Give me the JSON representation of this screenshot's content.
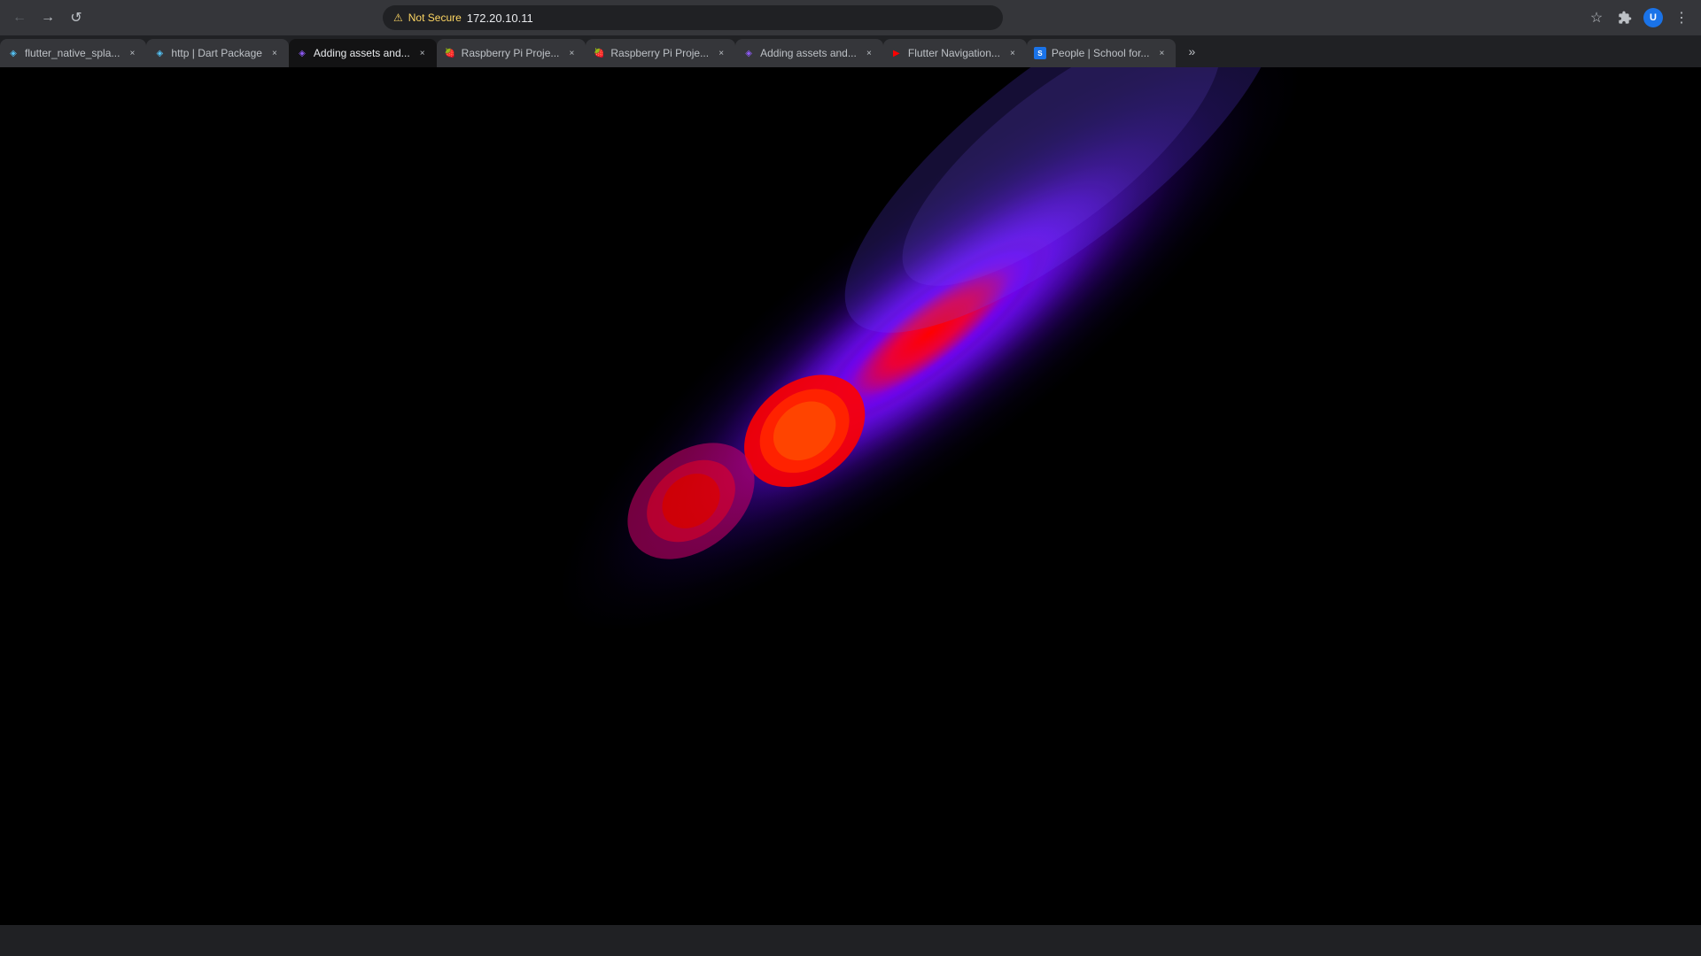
{
  "browser": {
    "url": "172.20.10.11",
    "security_label": "Not Secure",
    "nav": {
      "back_label": "←",
      "forward_label": "→",
      "reload_label": "↺"
    },
    "toolbar": {
      "bookmark_label": "☆",
      "extensions_label": "🧩",
      "menu_label": "⋮"
    }
  },
  "tabs": [
    {
      "id": "tab1",
      "title": "flutter_native_spla...",
      "favicon_type": "flutter",
      "active": false
    },
    {
      "id": "tab2",
      "title": "http | Dart Package",
      "favicon_type": "dart",
      "active": false
    },
    {
      "id": "tab3",
      "title": "Adding assets and...",
      "favicon_type": "flutter2",
      "active": true
    },
    {
      "id": "tab4",
      "title": "Raspberry Pi Proje...",
      "favicon_type": "raspi",
      "active": false
    },
    {
      "id": "tab5",
      "title": "Raspberry Pi Proje...",
      "favicon_type": "raspi",
      "active": false
    },
    {
      "id": "tab6",
      "title": "Adding assets and...",
      "favicon_type": "flutter2",
      "active": false
    },
    {
      "id": "tab7",
      "title": "Flutter Navigation...",
      "favicon_type": "youtube",
      "active": false
    },
    {
      "id": "tab8",
      "title": "People | School for...",
      "favicon_type": "school",
      "active": false
    }
  ],
  "tabs_overflow_label": "»",
  "page": {
    "background": "#000000"
  }
}
